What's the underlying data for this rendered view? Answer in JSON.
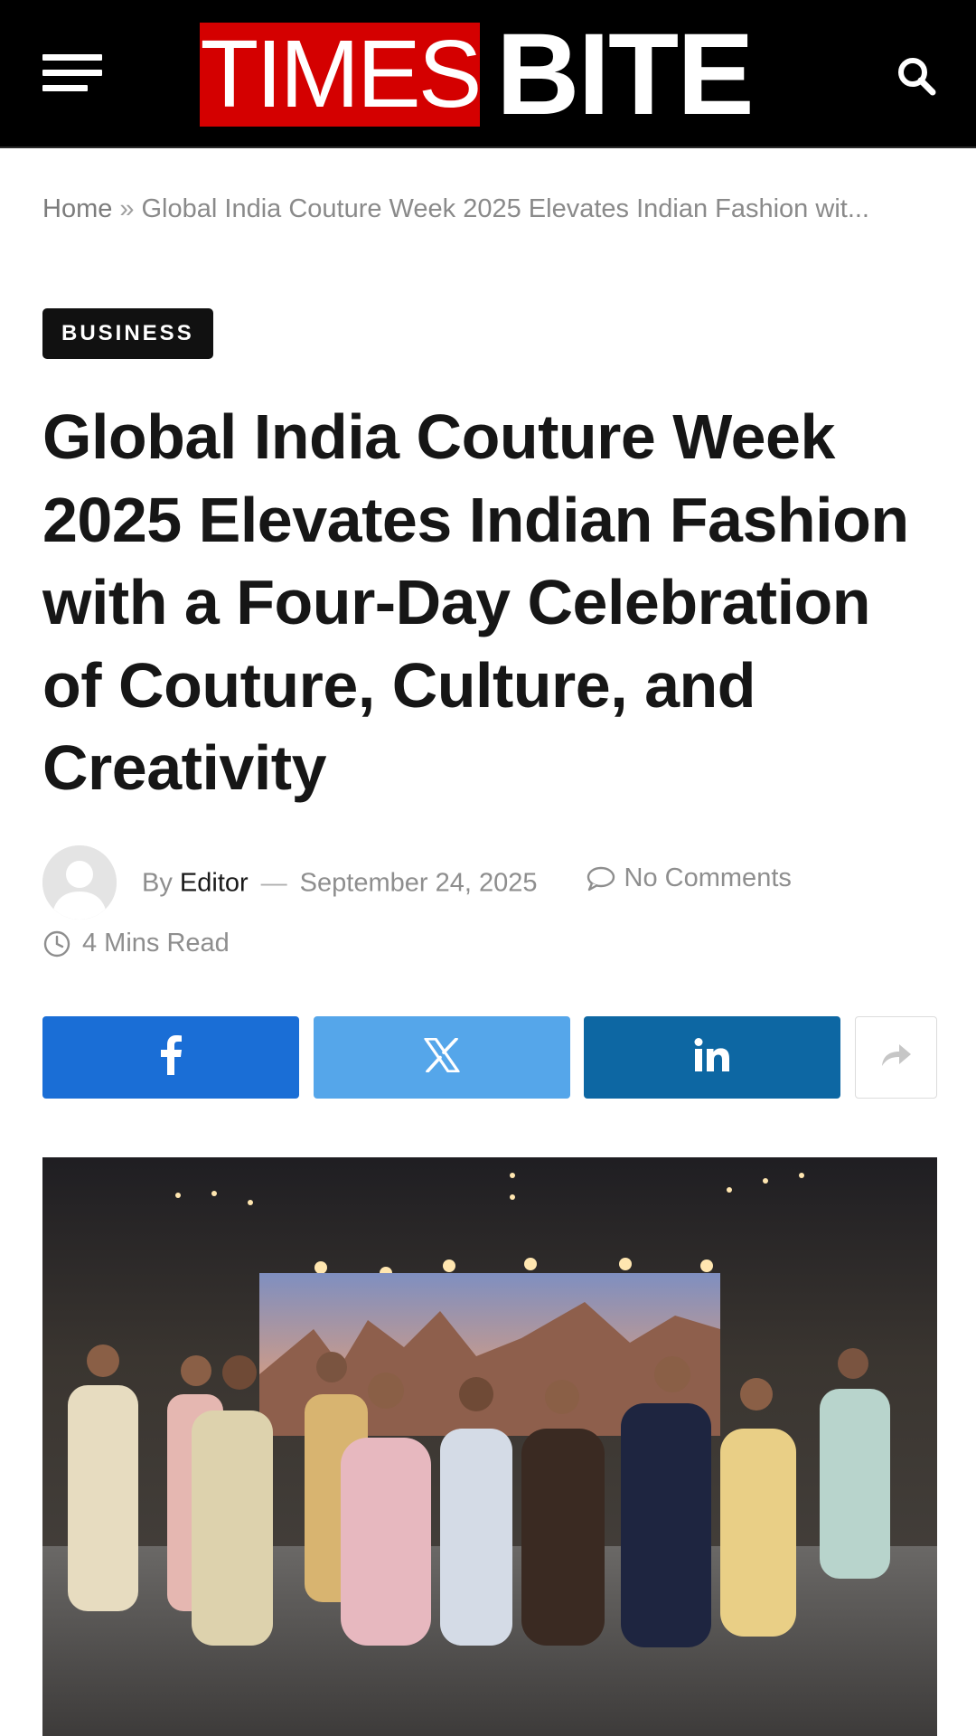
{
  "header": {
    "logo_times": "TIMES",
    "logo_bite": "BITE",
    "menu_icon": "hamburger-menu-icon",
    "search_icon": "search-icon"
  },
  "breadcrumb": {
    "home": "Home",
    "separator": "»",
    "current": "Global India Couture Week 2025 Elevates Indian Fashion wit..."
  },
  "article": {
    "category": "BUSINESS",
    "title": "Global India Couture Week 2025 Elevates Indian Fashion with a Four-Day Celebration of Couture, Culture, and Creativity",
    "by": "By",
    "author": "Editor",
    "dash": "—",
    "date": "September 24, 2025",
    "comments": "No Comments",
    "read_time": "4 Mins Read"
  },
  "share": {
    "facebook_icon": "facebook-icon",
    "x_icon": "x-icon",
    "linkedin_icon": "linkedin-icon",
    "more_icon": "share-arrow-icon"
  },
  "colors": {
    "header_bg": "#000000",
    "logo_red": "#d40000",
    "facebook": "#1a6ed6",
    "x": "#55a6ea",
    "linkedin": "#0d67a3"
  }
}
